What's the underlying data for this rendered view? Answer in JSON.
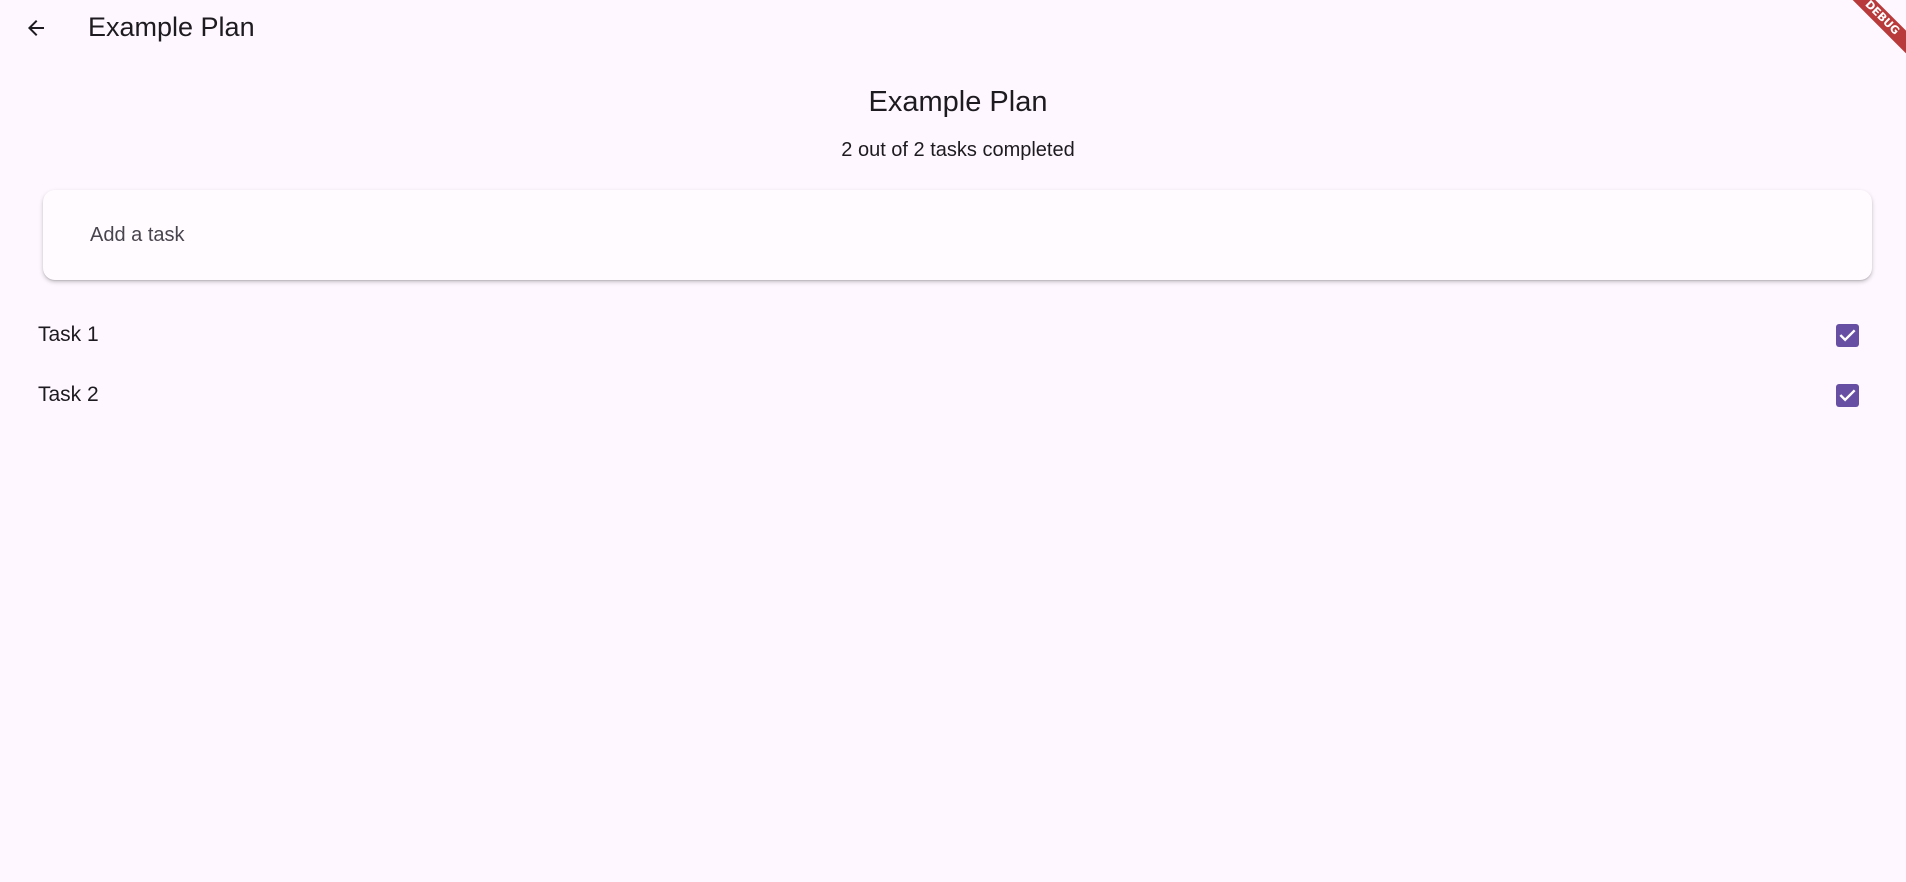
{
  "appbar": {
    "title": "Example Plan",
    "back_icon": "arrow-back-icon"
  },
  "debug_banner": "DEBUG",
  "plan": {
    "title": "Example Plan",
    "progress": "2 out of 2 tasks completed"
  },
  "add_task": {
    "placeholder": "Add a task",
    "value": ""
  },
  "tasks": [
    {
      "label": "Task 1",
      "completed": true
    },
    {
      "label": "Task 2",
      "completed": true
    }
  ],
  "colors": {
    "background": "#fef7ff",
    "accent": "#6750a4",
    "debug_ribbon": "#b83a3a"
  }
}
